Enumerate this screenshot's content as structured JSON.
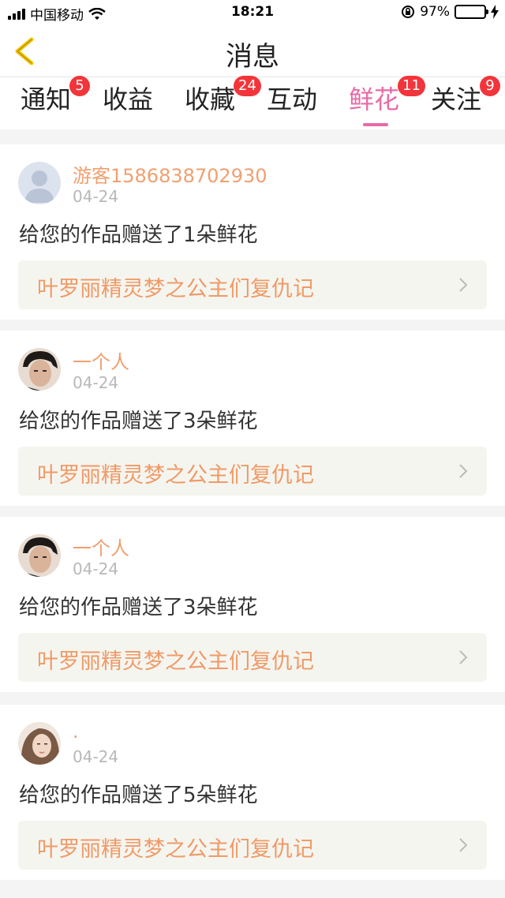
{
  "status_bar": {
    "carrier": "中国移动",
    "time": "18:21",
    "battery_percent": "97%",
    "battery_level": 0.97,
    "icons": [
      "signal-icon",
      "wifi-icon",
      "orientation-lock-icon",
      "battery-icon",
      "charging-icon"
    ]
  },
  "header": {
    "title": "消息",
    "back_icon": "chevron-left-icon",
    "accent_color": "#f5c400"
  },
  "tabs": [
    {
      "label": "通知",
      "badge": "5",
      "active": false
    },
    {
      "label": "收益",
      "badge": "",
      "active": false
    },
    {
      "label": "收藏",
      "badge": "24",
      "active": false
    },
    {
      "label": "互动",
      "badge": "",
      "active": false
    },
    {
      "label": "鲜花",
      "badge": "11",
      "active": true
    },
    {
      "label": "关注",
      "badge": "9",
      "active": false
    }
  ],
  "colors": {
    "active_tab": "#e86aa6",
    "badge": "#f2353a",
    "username": "#f0a070",
    "work_title": "#f09a66"
  },
  "messages": [
    {
      "user": "游客1586838702930",
      "date": "04-24",
      "text": "给您的作品赠送了1朵鲜花",
      "work": "叶罗丽精灵梦之公主们复仇记",
      "avatar": "default-avatar-icon"
    },
    {
      "user": "一个人",
      "date": "04-24",
      "text": "给您的作品赠送了3朵鲜花",
      "work": "叶罗丽精灵梦之公主们复仇记",
      "avatar": "male-avatar"
    },
    {
      "user": "一个人",
      "date": "04-24",
      "text": "给您的作品赠送了3朵鲜花",
      "work": "叶罗丽精灵梦之公主们复仇记",
      "avatar": "male-avatar"
    },
    {
      "user": ".",
      "date": "04-24",
      "text": "给您的作品赠送了5朵鲜花",
      "work": "叶罗丽精灵梦之公主们复仇记",
      "avatar": "female-avatar"
    }
  ]
}
